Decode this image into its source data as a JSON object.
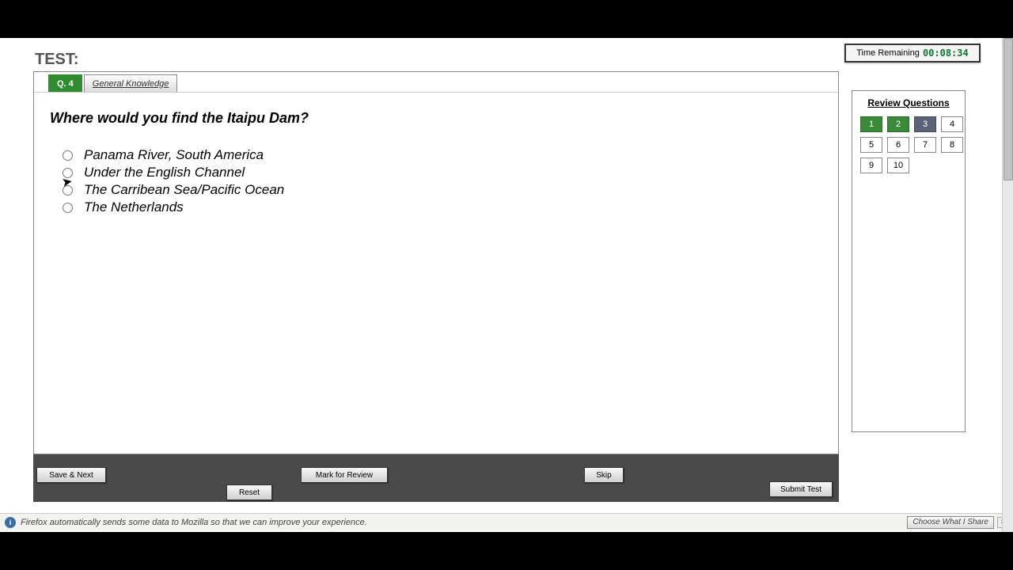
{
  "header": {
    "test_label": "TEST:"
  },
  "timer": {
    "label": "Time Remaining",
    "value": "00:08:34"
  },
  "tabs": {
    "qnum": "Q. 4",
    "category": "General Knowledge"
  },
  "question": {
    "text": "Where would you find the Itaipu Dam?",
    "options": [
      "Panama River, South America",
      "Under the English Channel",
      "The Carribean Sea/Pacific Ocean",
      "The Netherlands"
    ]
  },
  "review": {
    "title": "Review Questions",
    "items": [
      {
        "n": "1",
        "state": "answered"
      },
      {
        "n": "2",
        "state": "answered"
      },
      {
        "n": "3",
        "state": "review"
      },
      {
        "n": "4",
        "state": ""
      },
      {
        "n": "5",
        "state": ""
      },
      {
        "n": "6",
        "state": ""
      },
      {
        "n": "7",
        "state": ""
      },
      {
        "n": "8",
        "state": ""
      },
      {
        "n": "9",
        "state": ""
      },
      {
        "n": "10",
        "state": ""
      }
    ]
  },
  "actions": {
    "save_next": "Save & Next",
    "reset": "Reset",
    "mark_review": "Mark for Review",
    "skip": "Skip",
    "submit": "Submit Test"
  },
  "notif": {
    "text": "Firefox automatically sends some data to Mozilla so that we can improve your experience.",
    "choose": "Choose What I Share",
    "close": "×"
  }
}
